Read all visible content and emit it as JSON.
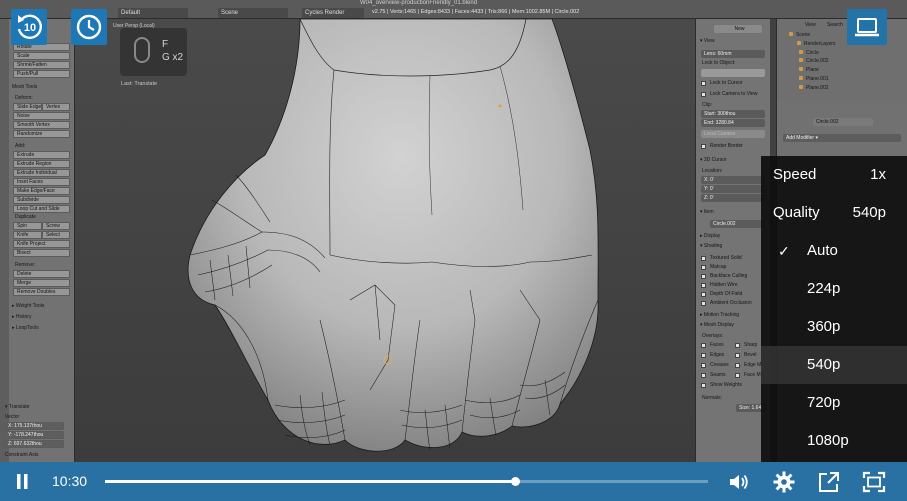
{
  "blender": {
    "file_title": "W04_overview-productionFriendly_01.blend",
    "layout": "Default",
    "scene": "Scene",
    "engine": "Cycles Render",
    "stats": "v2.75 | Verts:1465 | Edges:8433 | Faces:4433 | Tris:866 | Mem:1002.85M | Circle.002",
    "view_label": "User Persp (Local)",
    "last_op": "Last: Translate",
    "key_f": "F",
    "key_g": "G x2",
    "tools": {
      "items": [
        "Rotate",
        "Scale",
        "Shrink/Fatten",
        "Push/Pull"
      ],
      "mesh_tools": "Mesh Tools",
      "deform": "Deform:",
      "deform_items": [
        "Slide Edge",
        "Vertex",
        "Noise",
        "Smooth Vertex",
        "Randomize"
      ],
      "add": "Add:",
      "add_items": [
        "Extrude",
        "Extrude Region",
        "Extrude Individual",
        "Inset Faces",
        "Make Edge/Face",
        "Subdivide",
        "Loop Cut and Slide",
        "Duplicate",
        "Spin",
        "Screw",
        "Knife",
        "Select",
        "Knife Project",
        "Bisect"
      ],
      "remove": "Remove:",
      "remove_items": [
        "Delete",
        "Merge",
        "Remove Doubles"
      ],
      "sections": [
        "Weight Tools",
        "History",
        "LoopTools"
      ],
      "translate": "Translate",
      "vector": "Vector",
      "vx": "X:    175.137thou",
      "vy": "Y:   -178.247thou",
      "vz": "Z:    697.632thou",
      "constraint": "Constraint Axis"
    },
    "npanel": {
      "new": "New",
      "view": "View",
      "lens": "Lens:         60mm",
      "lock_obj": "Lock to Object:",
      "lock_cursor": "Lock to Cursor",
      "lock_cam": "Lock Camera to View",
      "clip": "Clip:",
      "clip_start": "Start:      300thou",
      "clip_end": "End:       3280.84",
      "local_camera": "Local Camera",
      "render_border": "Render Border",
      "cursor": "3D Cursor",
      "location": "Location:",
      "cx": "X:                0'",
      "cy": "Y:                0'",
      "cz": "Z:                0'",
      "item": "Item",
      "item_name": "Circle.002",
      "display": "Display",
      "shading": "Shading",
      "shading_items": [
        "Textured Solid",
        "Matcap",
        "Backface Culling",
        "Hidden Wire",
        "Depth Of Field",
        "Ambient Occlusion"
      ],
      "motion": "Motion Tracking",
      "mesh_display": "Mesh Display",
      "overlays": "Overlays:",
      "ov_left": [
        "Faces",
        "Edges",
        "Creases",
        "Seams",
        "Show Weights"
      ],
      "ov_right": [
        "Sharp",
        "Bevel",
        "Edge M",
        "Face M"
      ],
      "normals": "Normals:",
      "size": "Size: 1.64"
    },
    "outliner": {
      "view": "View",
      "search": "Search",
      "all": "All S",
      "items": [
        "Scene",
        "RenderLayers",
        "Circle",
        "Circle.002",
        "Plane",
        "Plane.001",
        "Plane.002"
      ]
    },
    "props": {
      "obj": "Circle.002",
      "add_modifier": "Add Modifier"
    }
  },
  "player": {
    "skip_label": "10",
    "time": "10:30",
    "progress": 0.68,
    "quality_menu": {
      "speed_label": "Speed",
      "speed_value": "1x",
      "quality_label": "Quality",
      "quality_value": "540p",
      "options": [
        "Auto",
        "224p",
        "360p",
        "540p",
        "720p",
        "1080p"
      ],
      "checked": "Auto",
      "highlighted": "540p"
    }
  }
}
